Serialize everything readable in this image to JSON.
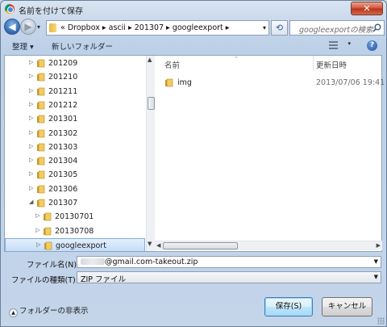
{
  "window": {
    "title": "名前を付けて保存",
    "close_label": "✕"
  },
  "nav": {
    "back_glyph": "◀",
    "forward_glyph": "▶",
    "address_path": "«  Dropbox  ▸  ascii  ▸  201307  ▸  googleexport  ▸",
    "search_placeholder": "googleexportの検索"
  },
  "toolbar": {
    "organize_label": "整理 ▾",
    "new_folder_label": "新しいフォルダー"
  },
  "tree": {
    "items": [
      {
        "label": "201209",
        "expanded": false
      },
      {
        "label": "201210",
        "expanded": false
      },
      {
        "label": "201211",
        "expanded": false
      },
      {
        "label": "201212",
        "expanded": false
      },
      {
        "label": "201301",
        "expanded": false
      },
      {
        "label": "201302",
        "expanded": false
      },
      {
        "label": "201303",
        "expanded": false
      },
      {
        "label": "201304",
        "expanded": false
      },
      {
        "label": "201305",
        "expanded": false
      },
      {
        "label": "201306",
        "expanded": false
      },
      {
        "label": "201307",
        "expanded": true
      },
      {
        "label": "20130701",
        "expanded": false
      },
      {
        "label": "20130708",
        "expanded": false
      },
      {
        "label": "googleexport",
        "expanded": false,
        "selected": true
      }
    ]
  },
  "files": {
    "columns": {
      "name": "名前",
      "modified": "更新日時"
    },
    "rows": [
      {
        "name": "img",
        "modified": "2013/07/06 19:41"
      }
    ]
  },
  "form": {
    "filename_label": "ファイル名(N):",
    "filename_value": "@gmail.com-takeout.zip",
    "filetype_label": "ファイルの種類(T):",
    "filetype_value": "ZIP ファイル"
  },
  "footer": {
    "hide_folders_label": "フォルダーの非表示",
    "save_label": "保存(S)",
    "cancel_label": "キャンセル"
  },
  "colors": {
    "selection": "#c5ddf8",
    "folder": "#e6b842",
    "chrome": "#c6d6ea"
  }
}
